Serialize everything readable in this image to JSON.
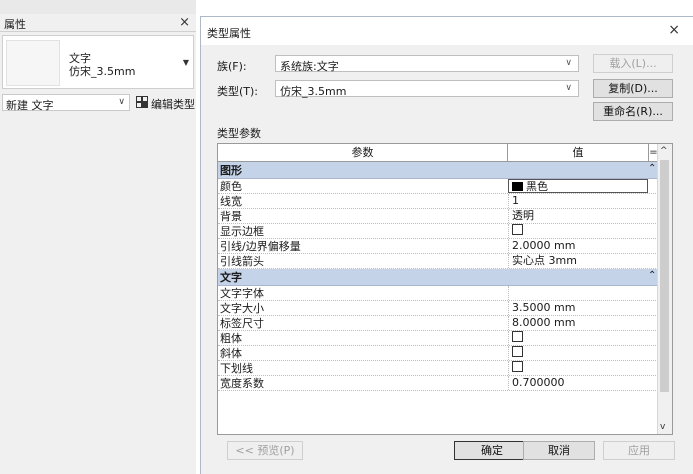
{
  "palette": {
    "title": "属性",
    "close": "×",
    "type_line1": "文字",
    "type_line2": "仿宋_3.5mm",
    "new_selector": "新建 文字",
    "edit_type_label": "编辑类型"
  },
  "dialog": {
    "title": "类型属性",
    "close": "×",
    "family_label": "族(F):",
    "family_value": "系统族:文字",
    "type_label": "类型(T):",
    "type_value": "仿宋_3.5mm",
    "load_button": "载入(L)...",
    "duplicate_button": "复制(D)...",
    "rename_button": "重命名(R)...",
    "section_label": "类型参数",
    "col_param": "参数",
    "col_value": "值",
    "col_extra": "=",
    "groups": [
      {
        "name": "图形",
        "rows": [
          {
            "name": "颜色",
            "value": "黑色",
            "kind": "color",
            "color": "#000000"
          },
          {
            "name": "线宽",
            "value": "1",
            "kind": "text"
          },
          {
            "name": "背景",
            "value": "透明",
            "kind": "text"
          },
          {
            "name": "显示边框",
            "value": "",
            "kind": "checkbox",
            "checked": false
          },
          {
            "name": "引线/边界偏移量",
            "value": "2.0000 mm",
            "kind": "text"
          },
          {
            "name": "引线箭头",
            "value": "实心点 3mm",
            "kind": "text"
          }
        ]
      },
      {
        "name": "文字",
        "rows": [
          {
            "name": "文字字体",
            "value": "",
            "kind": "text"
          },
          {
            "name": "文字大小",
            "value": "3.5000 mm",
            "kind": "text"
          },
          {
            "name": "标签尺寸",
            "value": "8.0000 mm",
            "kind": "text"
          },
          {
            "name": "粗体",
            "value": "",
            "kind": "checkbox",
            "checked": false
          },
          {
            "name": "斜体",
            "value": "",
            "kind": "checkbox",
            "checked": false
          },
          {
            "name": "下划线",
            "value": "",
            "kind": "checkbox",
            "checked": false
          },
          {
            "name": "宽度系数",
            "value": "0.700000",
            "kind": "text"
          }
        ]
      }
    ],
    "preview_button": "<< 预览(P)",
    "ok_button": "确定",
    "cancel_button": "取消",
    "apply_button": "应用"
  }
}
